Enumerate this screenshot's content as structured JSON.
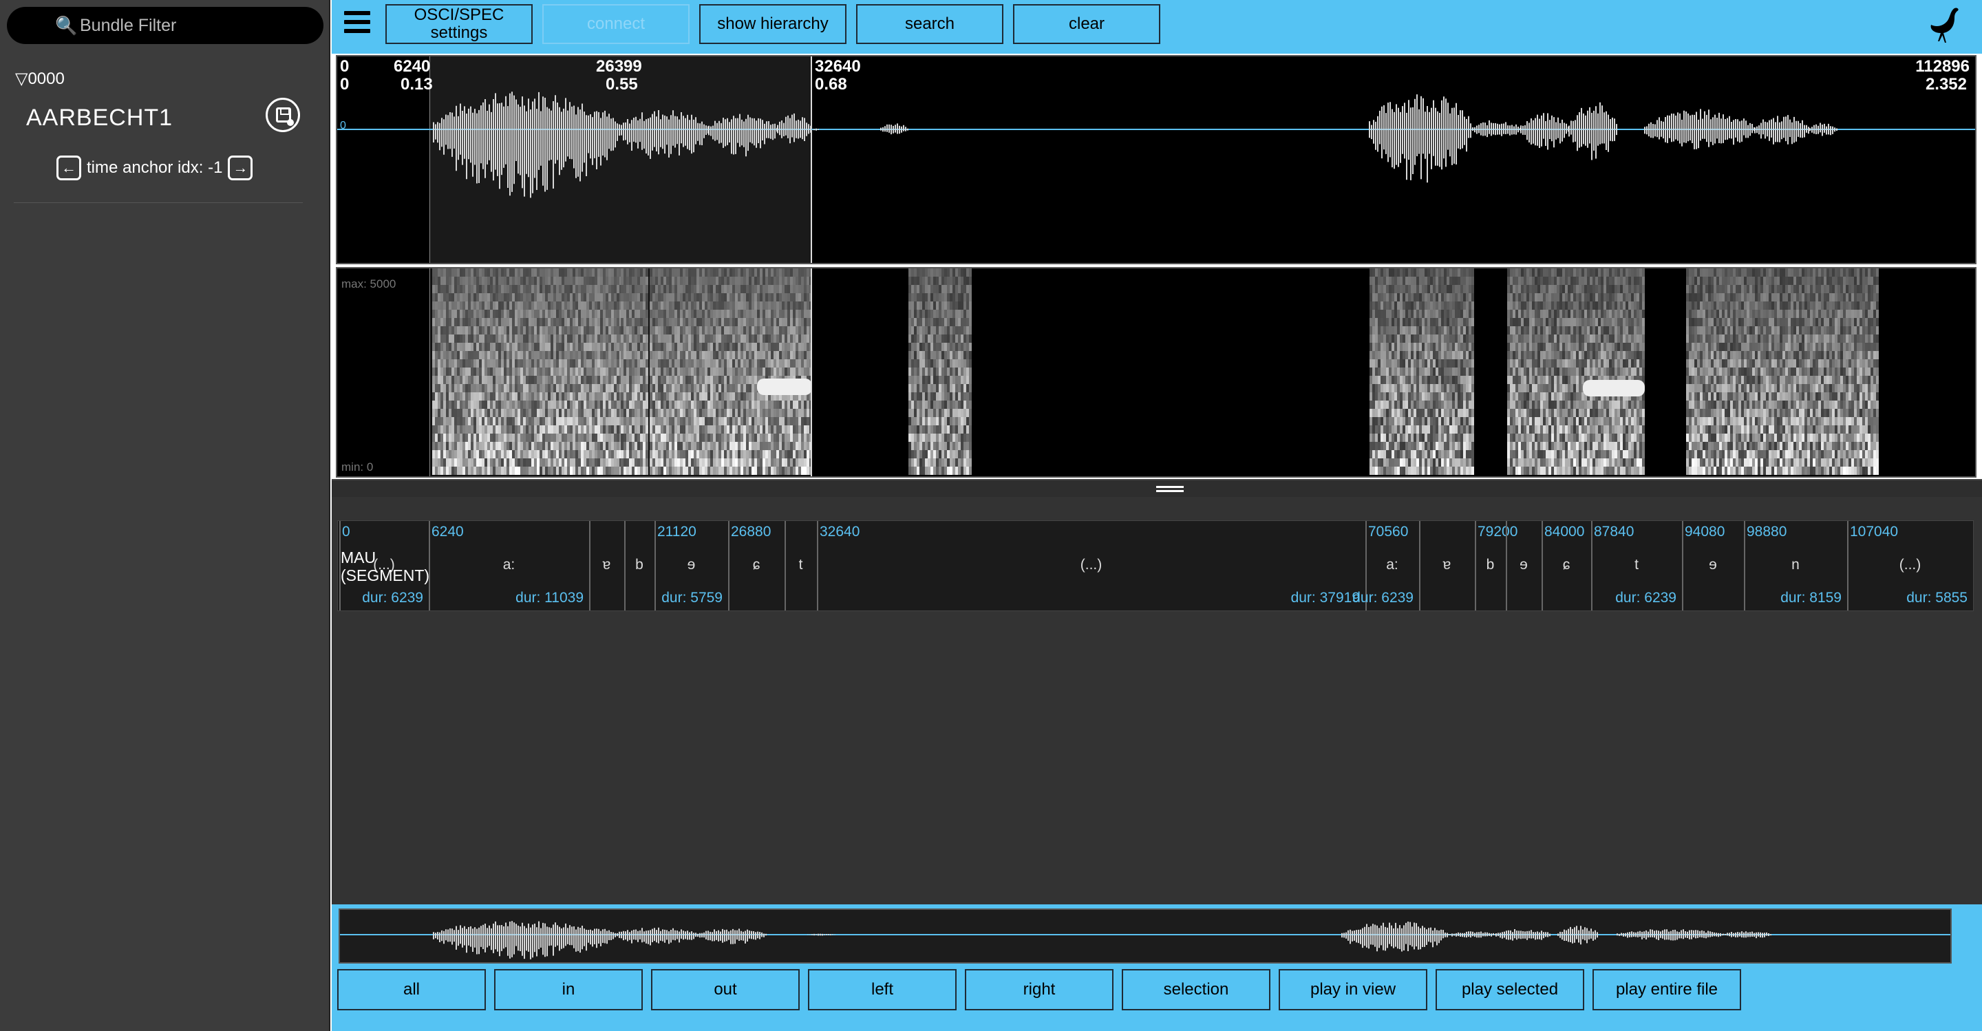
{
  "sidebar": {
    "filter_placeholder": "Bundle Filter",
    "session_label": "▽0000",
    "bundle_name": "AARBECHT1",
    "anchor_label": "time anchor idx: -1"
  },
  "toolbar": {
    "settings_line1": "OSCI/SPEC",
    "settings_line2": "settings",
    "connect": "connect",
    "hierarchy": "show hierarchy",
    "search": "search",
    "clear": "clear"
  },
  "osci": {
    "view_start_sample": "0",
    "view_start_time": "0",
    "sel_start_sample": "6240",
    "sel_start_time": "0.13",
    "cursor_sample": "26399",
    "cursor_time": "0.55",
    "sel_end_sample": "32640",
    "sel_end_time": "0.68",
    "view_end_sample": "112896",
    "view_end_time": "2.352",
    "zero_label": "0"
  },
  "spec": {
    "max_label": "max: 5000",
    "min_label": "min: 0"
  },
  "level": {
    "name_line1": "MAU",
    "name_line2": "(SEGMENT)",
    "segments": [
      {
        "start": "0",
        "label": "(...)",
        "dur": "dur: 6239"
      },
      {
        "start": "6240",
        "label": "a:",
        "dur": "dur: 11039"
      },
      {
        "start": "",
        "label": "ɐ",
        "dur": ""
      },
      {
        "start": "",
        "label": "b",
        "dur": ""
      },
      {
        "start": "21120",
        "label": "ɘ",
        "dur": "dur: 5759"
      },
      {
        "start": "26880",
        "label": "ɕ",
        "dur": ""
      },
      {
        "start": "",
        "label": "t",
        "dur": ""
      },
      {
        "start": "32640",
        "label": "(...)",
        "dur": "dur: 37919"
      },
      {
        "start": "70560",
        "label": "a:",
        "dur": "dur: 6239"
      },
      {
        "start": "",
        "label": "ɐ",
        "dur": ""
      },
      {
        "start": "79200",
        "label": "b",
        "dur": ""
      },
      {
        "start": "",
        "label": "ɘ",
        "dur": ""
      },
      {
        "start": "84000",
        "label": "ɕ",
        "dur": ""
      },
      {
        "start": "87840",
        "label": "t",
        "dur": "dur: 6239"
      },
      {
        "start": "94080",
        "label": "ɘ",
        "dur": ""
      },
      {
        "start": "98880",
        "label": "n",
        "dur": "dur: 8159"
      },
      {
        "start": "107040",
        "label": "(...)",
        "dur": "dur: 5855"
      }
    ]
  },
  "bottom": {
    "buttons": [
      "all",
      "in",
      "out",
      "left",
      "right",
      "selection",
      "play in view",
      "play selected",
      "play entire file"
    ]
  },
  "colors": {
    "accent": "#55c3f3",
    "panel_bg": "#3c3c3c",
    "signal": "#d8d8d8",
    "label_blue": "#5bc0f0"
  }
}
